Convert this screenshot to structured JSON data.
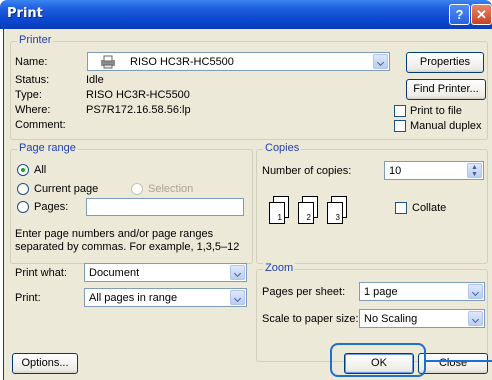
{
  "window": {
    "title": "Print",
    "help_glyph": "?",
    "close_glyph": "✕"
  },
  "printer": {
    "group_label": "Printer",
    "name_label": "Name:",
    "name_value": "RISO HC3R-HC5500",
    "status_label": "Status:",
    "status_value": "Idle",
    "type_label": "Type:",
    "type_value": "RISO HC3R-HC5500",
    "where_label": "Where:",
    "where_value": "PS7R172.16.58.56:lp",
    "comment_label": "Comment:",
    "properties_label": "Properties",
    "find_printer_label": "Find Printer...",
    "print_to_file_label": "Print to file",
    "manual_duplex_label": "Manual duplex"
  },
  "page_range": {
    "group_label": "Page range",
    "all_label": "All",
    "current_page_label": "Current page",
    "selection_label": "Selection",
    "pages_label": "Pages:",
    "help_text": "Enter page numbers and/or page ranges separated by commas.  For example, 1,3,5–12"
  },
  "copies": {
    "group_label": "Copies",
    "number_label": "Number of copies:",
    "number_value": "10",
    "collate_label": "Collate",
    "page_numbers": [
      "1",
      "2",
      "3"
    ]
  },
  "print_what": {
    "label": "Print what:",
    "value": "Document"
  },
  "print": {
    "label": "Print:",
    "value": "All pages in range"
  },
  "zoom": {
    "group_label": "Zoom",
    "pages_per_sheet_label": "Pages per sheet:",
    "pages_per_sheet_value": "1 page",
    "scale_label": "Scale to paper size:",
    "scale_value": "No Scaling"
  },
  "buttons": {
    "options": "Options...",
    "ok": "OK",
    "close": "Close"
  }
}
